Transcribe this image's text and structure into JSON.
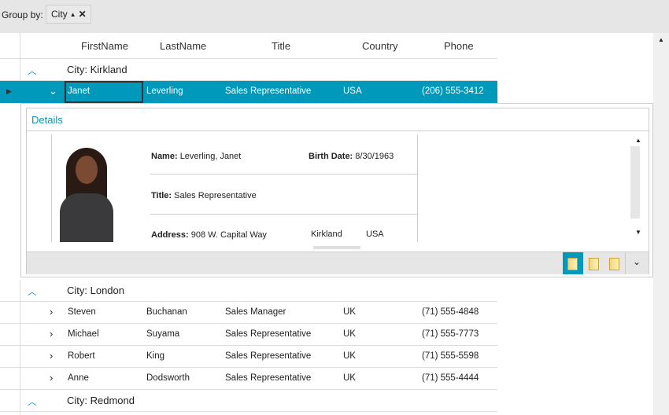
{
  "group_bar": {
    "label": "Group by:",
    "chip": "City",
    "chip_sort": "▲",
    "chip_remove": "✕"
  },
  "columns": [
    "FirstName",
    "LastName",
    "Title",
    "Country",
    "Phone"
  ],
  "groups": [
    {
      "header": "City: Kirkland",
      "rows": [
        {
          "first": "Janet",
          "last": "Leverling",
          "title": "Sales Representative",
          "country": "USA",
          "phone": "(206) 555-3412"
        }
      ]
    },
    {
      "header": "City: London",
      "rows": [
        {
          "first": "Steven",
          "last": "Buchanan",
          "title": "Sales Manager",
          "country": "UK",
          "phone": "(71) 555-4848"
        },
        {
          "first": "Michael",
          "last": "Suyama",
          "title": "Sales Representative",
          "country": "UK",
          "phone": "(71) 555-7773"
        },
        {
          "first": "Robert",
          "last": "King",
          "title": "Sales Representative",
          "country": "UK",
          "phone": "(71) 555-5598"
        },
        {
          "first": "Anne",
          "last": "Dodsworth",
          "title": "Sales Representative",
          "country": "UK",
          "phone": "(71) 555-4444"
        }
      ]
    },
    {
      "header": "City: Redmond",
      "rows": []
    }
  ],
  "details": {
    "title": "Details",
    "name_label": "Name:",
    "name": "Leverling, Janet",
    "birth_label": "Birth Date:",
    "birth": "8/30/1963",
    "title_label": "Title:",
    "title_value": "Sales Representative",
    "address_label": "Address:",
    "address": "908 W. Capital Way",
    "city": "Kirkland",
    "country": "USA"
  },
  "colors": {
    "accent": "#0099bc"
  }
}
